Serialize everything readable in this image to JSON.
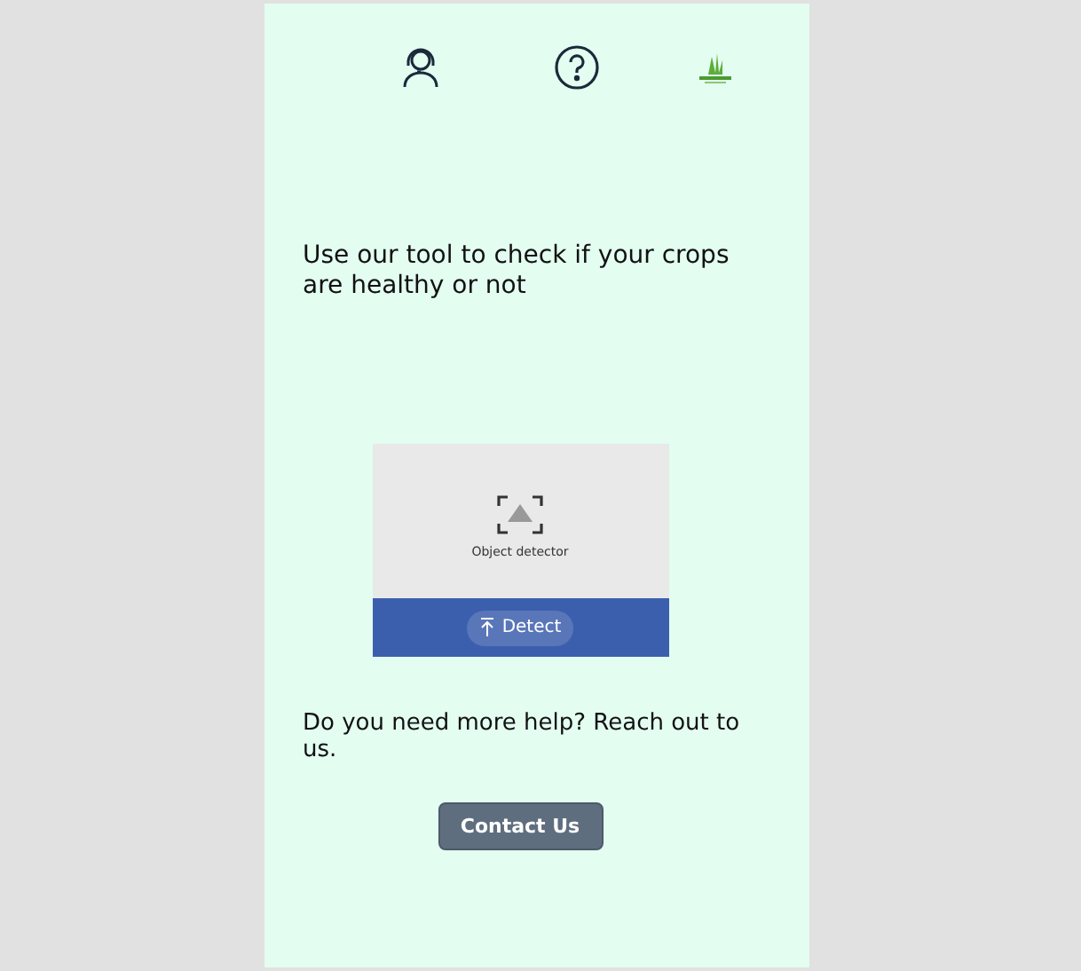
{
  "intro": "Use our tool to check if your crops are healthy or not",
  "detector": {
    "label": "Object detector",
    "button": "Detect"
  },
  "help": "Do you need more help? Reach out to us.",
  "contact_button": "Contact Us"
}
